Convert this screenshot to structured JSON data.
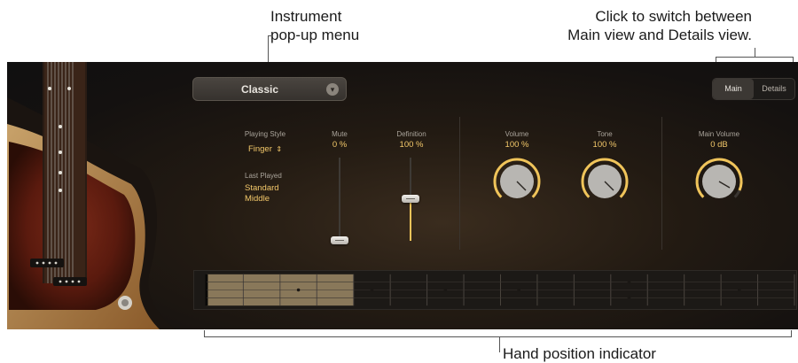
{
  "callouts": {
    "instrument_line1": "Instrument",
    "instrument_line2": "pop-up menu",
    "switch_line1": "Click to switch between",
    "switch_line2": "Main view and Details view.",
    "hand_position": "Hand position indicator"
  },
  "instrument_menu": {
    "selected": "Classic"
  },
  "view_switch": {
    "main": "Main",
    "details": "Details",
    "active": "Main"
  },
  "playing_style": {
    "label": "Playing Style",
    "value": "Finger",
    "chevron_icon": "updown-chevron-icon"
  },
  "last_played": {
    "label": "Last Played",
    "value_line1": "Standard",
    "value_line2": "Middle"
  },
  "mute": {
    "label": "Mute",
    "value": "0 %",
    "level": 0.0
  },
  "definition": {
    "label": "Definition",
    "value": "100 %",
    "level": 0.5
  },
  "volume": {
    "label": "Volume",
    "value": "100 %",
    "level": 0.75
  },
  "tone": {
    "label": "Tone",
    "value": "100 %",
    "level": 0.75
  },
  "main_volume": {
    "label": "Main Volume",
    "value": "0 dB",
    "level": 0.68
  },
  "fretboard": {
    "frets": 16,
    "hand_position_frets": 4,
    "single_dot_frets": [
      3,
      5,
      7,
      9,
      15
    ],
    "double_dot_frets": [
      12
    ]
  },
  "colors": {
    "accent": "#f3c86a",
    "panel": "#1a1512",
    "label": "#a9a39a"
  }
}
